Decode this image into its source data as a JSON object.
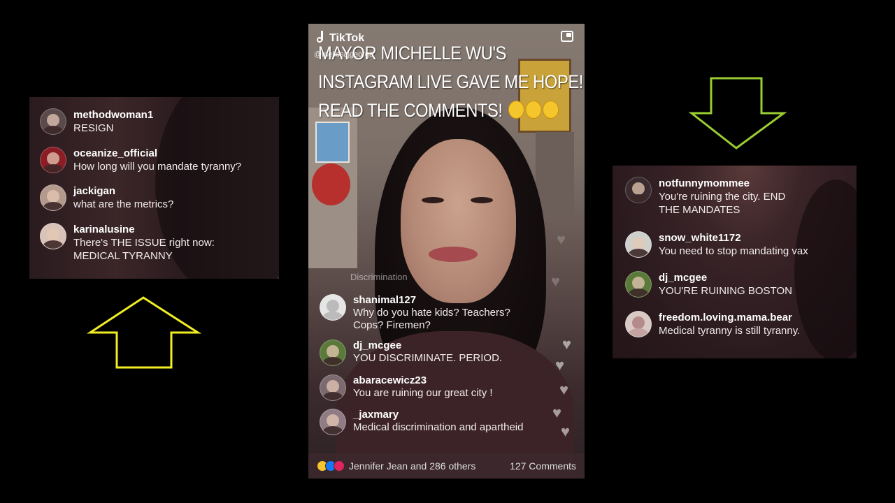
{
  "left_panel": {
    "comments": [
      {
        "username": "methodwoman1",
        "text": "RESIGN"
      },
      {
        "username": "oceanize_official",
        "text": "How long will you mandate tyranny?"
      },
      {
        "username": "jackigan",
        "text": "what are the metrics?"
      },
      {
        "username": "karinalusine",
        "text": "There's THE ISSUE right now:",
        "text2": "MEDICAL TYRANNY"
      }
    ],
    "arrow_color": "#f2ee22"
  },
  "phone": {
    "app_name": "TikTok",
    "handle": "@melissajgeorge",
    "caption": [
      "MAYOR MICHELLE WU'S",
      "INSTAGRAM LIVE GAVE ME HOPE!!",
      "READ THE COMMENTS!"
    ],
    "faded_label": "Discrimination",
    "comments": [
      {
        "username": "shanimal127",
        "text": "Why do you hate kids? Teachers?",
        "text2": "Cops? Firemen?"
      },
      {
        "username": "dj_mcgee",
        "text": "YOU DISCRIMINATE. PERIOD."
      },
      {
        "username": "abaracewicz23",
        "text": "You are ruining our great city !"
      },
      {
        "username": "_jaxmary",
        "text": "Medical discrimination and apartheid"
      }
    ],
    "footer": {
      "likers": "Jennifer Jean and 286 others",
      "comment_count": "127 Comments"
    },
    "icons": [
      "tiktok-note-icon",
      "picture-in-picture-icon",
      "laughing-emoji-icon",
      "heart-icon"
    ]
  },
  "right_panel": {
    "comments": [
      {
        "username": "notfunnymommee",
        "text": "You're ruining the city. END",
        "text2": "THE MANDATES"
      },
      {
        "username": "snow_white1172",
        "text": "You need to stop mandating vax"
      },
      {
        "username": "dj_mcgee",
        "text": "YOU'RE RUINING BOSTON"
      },
      {
        "username": "freedom.loving.mama.bear",
        "text": "Medical tyranny is still tyranny."
      }
    ],
    "arrow_color": "#9acd32"
  }
}
